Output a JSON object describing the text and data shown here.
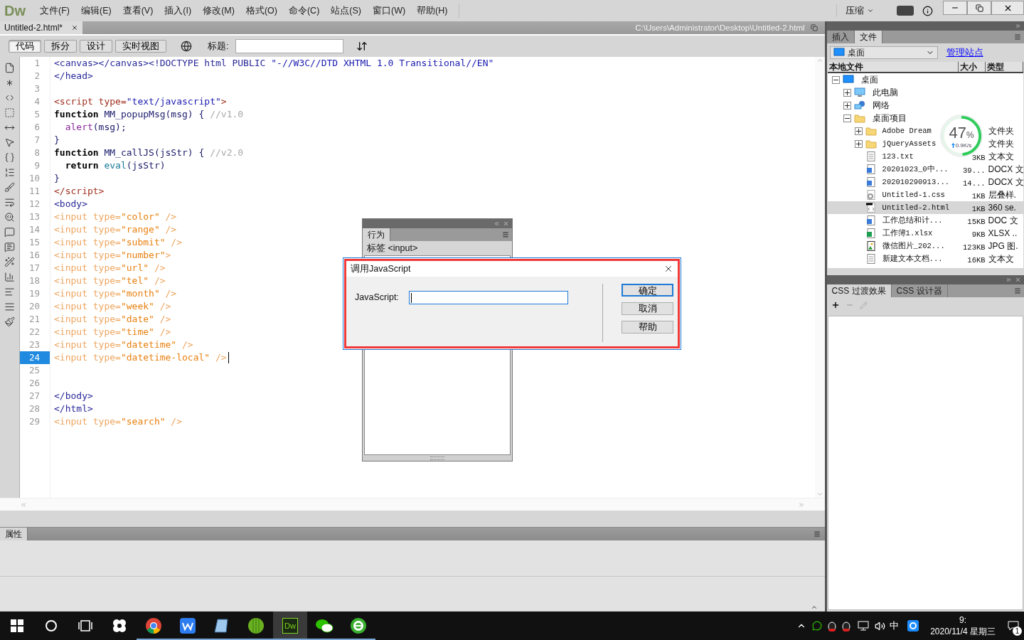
{
  "app": {
    "logo": "Dw",
    "menus": [
      "文件(F)",
      "编辑(E)",
      "查看(V)",
      "插入(I)",
      "修改(M)",
      "格式(O)",
      "命令(C)",
      "站点(S)",
      "窗口(W)",
      "帮助(H)"
    ],
    "workspace": "压缩"
  },
  "document": {
    "tab": "Untitled-2.html*",
    "path": "C:\\Users\\Administrator\\Desktop\\Untitled-2.html"
  },
  "toolbar": {
    "views": [
      {
        "label": "代码",
        "selected": true
      },
      {
        "label": "拆分",
        "selected": false
      },
      {
        "label": "设计",
        "selected": false
      },
      {
        "label": "实时视图",
        "selected": false
      }
    ],
    "title_label": "标题:"
  },
  "code": [
    {
      "number": "1",
      "current": false,
      "tokens": [
        {
          "kind": "markup",
          "text": "<canvas></canvas><!DOCTYPE html PUBLIC "
        },
        {
          "kind": "string",
          "text": "\"-//W3C//DTD XHTML 1.0 Transitional//EN\""
        }
      ]
    },
    {
      "number": "2",
      "current": false,
      "tokens": [
        {
          "kind": "markup",
          "text": "</head>"
        }
      ]
    },
    {
      "number": "3",
      "current": false
    },
    {
      "number": "4",
      "current": false,
      "tokens": [
        {
          "kind": "script_tag",
          "text": "<script type="
        },
        {
          "kind": "string",
          "text": "\"text/javascript\""
        },
        {
          "kind": "script_tag",
          "text": ">"
        }
      ]
    },
    {
      "number": "5",
      "current": false,
      "tokens": [
        {
          "kind": "keyword",
          "text": "function"
        },
        {
          "kind": "name",
          "text": " MM_popupMsg(msg) { "
        },
        {
          "kind": "comment",
          "text": "//v1.0"
        }
      ]
    },
    {
      "number": "6",
      "current": false,
      "tokens": [
        {
          "kind": "builtin",
          "text": "  alert"
        },
        {
          "kind": "name",
          "text": "(msg);"
        }
      ]
    },
    {
      "number": "7",
      "current": false,
      "tokens": [
        {
          "kind": "name",
          "text": "}"
        }
      ]
    },
    {
      "number": "8",
      "current": false,
      "tokens": [
        {
          "kind": "keyword",
          "text": "function"
        },
        {
          "kind": "name",
          "text": " MM_callJS(jsStr) { "
        },
        {
          "kind": "comment",
          "text": "//v2.0"
        }
      ]
    },
    {
      "number": "9",
      "current": false,
      "tokens": [
        {
          "kind": "keyword",
          "text": "  return"
        },
        {
          "kind": "call",
          "text": " eval"
        },
        {
          "kind": "name",
          "text": "(jsStr)"
        }
      ]
    },
    {
      "number": "10",
      "current": false,
      "tokens": [
        {
          "kind": "name",
          "text": "}"
        }
      ]
    },
    {
      "number": "11",
      "current": false,
      "tokens": [
        {
          "kind": "script_tag",
          "text": "</script>"
        }
      ]
    },
    {
      "number": "12",
      "current": false,
      "tokens": [
        {
          "kind": "markup",
          "text": "<body>"
        }
      ]
    },
    {
      "number": "13",
      "current": false,
      "tokens": [
        {
          "kind": "dim_tag",
          "text": "<input type="
        },
        {
          "kind": "dim_string",
          "text": "\"color\""
        },
        {
          "kind": "dim_tag",
          "text": " />"
        }
      ]
    },
    {
      "number": "14",
      "current": false,
      "tokens": [
        {
          "kind": "dim_tag",
          "text": "<input type="
        },
        {
          "kind": "dim_string",
          "text": "\"range\""
        },
        {
          "kind": "dim_tag",
          "text": " />"
        }
      ]
    },
    {
      "number": "15",
      "current": false,
      "tokens": [
        {
          "kind": "dim_tag",
          "text": "<input type="
        },
        {
          "kind": "dim_string",
          "text": "\"submit\""
        },
        {
          "kind": "dim_tag",
          "text": " />"
        }
      ]
    },
    {
      "number": "16",
      "current": false,
      "tokens": [
        {
          "kind": "dim_tag",
          "text": "<input type="
        },
        {
          "kind": "dim_string",
          "text": "\"number\""
        },
        {
          "kind": "dim_tag",
          "text": ">"
        }
      ]
    },
    {
      "number": "17",
      "current": false,
      "tokens": [
        {
          "kind": "dim_tag",
          "text": "<input type="
        },
        {
          "kind": "dim_string",
          "text": "\"url\""
        },
        {
          "kind": "dim_tag",
          "text": " />"
        }
      ]
    },
    {
      "number": "18",
      "current": false,
      "tokens": [
        {
          "kind": "dim_tag",
          "text": "<input type="
        },
        {
          "kind": "dim_string",
          "text": "\"tel\""
        },
        {
          "kind": "dim_tag",
          "text": " />"
        }
      ]
    },
    {
      "number": "19",
      "current": false,
      "tokens": [
        {
          "kind": "dim_tag",
          "text": "<input type="
        },
        {
          "kind": "dim_string",
          "text": "\"month\""
        },
        {
          "kind": "dim_tag",
          "text": " />"
        }
      ]
    },
    {
      "number": "20",
      "current": false,
      "tokens": [
        {
          "kind": "dim_tag",
          "text": "<input type="
        },
        {
          "kind": "dim_string",
          "text": "\"week\""
        },
        {
          "kind": "dim_tag",
          "text": " />"
        }
      ]
    },
    {
      "number": "21",
      "current": false,
      "tokens": [
        {
          "kind": "dim_tag",
          "text": "<input type="
        },
        {
          "kind": "dim_string",
          "text": "\"date\""
        },
        {
          "kind": "dim_tag",
          "text": " />"
        }
      ]
    },
    {
      "number": "22",
      "current": false,
      "tokens": [
        {
          "kind": "dim_tag",
          "text": "<input type="
        },
        {
          "kind": "dim_string",
          "text": "\"time\""
        },
        {
          "kind": "dim_tag",
          "text": " />"
        }
      ]
    },
    {
      "number": "23",
      "current": false,
      "tokens": [
        {
          "kind": "dim_tag",
          "text": "<input type="
        },
        {
          "kind": "dim_string",
          "text": "\"datetime\""
        },
        {
          "kind": "dim_tag",
          "text": " />"
        }
      ]
    },
    {
      "number": "24",
      "current": true,
      "tokens": [
        {
          "kind": "dim_tag",
          "text": "<input type="
        },
        {
          "kind": "dim_string",
          "text": "\"datetime-local\""
        },
        {
          "kind": "dim_tag",
          "text": " />"
        }
      ]
    },
    {
      "number": "25",
      "current": false
    },
    {
      "number": "26",
      "current": false
    },
    {
      "number": "27",
      "current": false,
      "tokens": [
        {
          "kind": "markup",
          "text": "</body>"
        }
      ]
    },
    {
      "number": "28",
      "current": false,
      "tokens": [
        {
          "kind": "markup",
          "text": "</html>"
        }
      ]
    },
    {
      "number": "29",
      "current": false,
      "tokens": [
        {
          "kind": "dim_tag",
          "text": "<input type="
        },
        {
          "kind": "dim_string",
          "text": "\"search\""
        },
        {
          "kind": "dim_tag",
          "text": " />"
        }
      ]
    }
  ],
  "behaviors_panel": {
    "tab": "行为",
    "tag_label": "标签 <input>"
  },
  "dialog": {
    "title": "调用JavaScript",
    "field_label": "JavaScript:",
    "buttons": [
      {
        "label": "确定",
        "default": true
      },
      {
        "label": "取消",
        "default": false
      },
      {
        "label": "帮助",
        "default": false
      }
    ]
  },
  "files_panel": {
    "tabs": [
      {
        "label": "插入",
        "selected": false
      },
      {
        "label": "文件",
        "selected": true
      }
    ],
    "location": "桌面",
    "manage_link": "管理站点",
    "columns": [
      "本地文件",
      "大小",
      "类型"
    ],
    "tree": [
      {
        "name": "桌面",
        "kind": "monitor",
        "expanded": true,
        "selected": false,
        "children": [
          {
            "name": "此电脑",
            "kind": "pc",
            "expanded": false,
            "selected": false
          },
          {
            "name": "网络",
            "kind": "network",
            "expanded": false,
            "selected": false
          },
          {
            "name": "桌面项目",
            "kind": "folder",
            "expanded": true,
            "selected": false,
            "children": [
              {
                "name": "Adobe Dream",
                "kind": "folder",
                "expanded": false,
                "selected": false,
                "type": "文件夹"
              },
              {
                "name": "jQueryAssets",
                "kind": "folder",
                "expanded": false,
                "selected": false,
                "type": "文件夹"
              },
              {
                "name": "123.txt",
                "kind": "text",
                "selected": false,
                "size": "3KB",
                "type": "文本文"
              },
              {
                "name": "20201023_0中...",
                "kind": "word",
                "selected": false,
                "size": "39...",
                "type": "DOCX 文"
              },
              {
                "name": "202010290913...",
                "kind": "word",
                "selected": false,
                "size": "14...",
                "type": "DOCX 文"
              },
              {
                "name": "Untitled-1.css",
                "kind": "css",
                "selected": false,
                "size": "1KB",
                "type": "层叠样."
              },
              {
                "name": "Untitled-2.html",
                "kind": "html",
                "selected": true,
                "size": "1KB",
                "type": "360 se."
              },
              {
                "name": "工作总结和计...",
                "kind": "word",
                "selected": false,
                "size": "15KB",
                "type": "DOC 文"
              },
              {
                "name": "工作簿1.xlsx",
                "kind": "sheet",
                "selected": false,
                "size": "9KB",
                "type": "XLSX .."
              },
              {
                "name": "微信图片_202...",
                "kind": "image",
                "selected": false,
                "size": "123KB",
                "type": "JPG 图."
              },
              {
                "name": "新建文本文档...",
                "kind": "text",
                "selected": false,
                "size": "16KB",
                "type": "文本文"
              }
            ]
          }
        ]
      }
    ]
  },
  "speed_widget": {
    "percent": "47",
    "unit": "%",
    "rate": "0.9K/s",
    "level": 0.47
  },
  "css_panel": {
    "tabs": [
      {
        "label": "CSS 过渡效果",
        "selected": true
      },
      {
        "label": "CSS 设计器",
        "selected": false
      }
    ]
  },
  "properties_panel": {
    "tab": "属性"
  },
  "taskbar": {
    "apps": [
      {
        "kind": "pinwheel",
        "running": false,
        "active": false
      },
      {
        "kind": "chrome",
        "running": true,
        "active": false
      },
      {
        "kind": "wps",
        "running": true,
        "active": false
      },
      {
        "kind": "tablet",
        "running": true,
        "active": false
      },
      {
        "kind": "ball",
        "running": true,
        "active": false
      },
      {
        "kind": "dw",
        "label": "Dw",
        "running": true,
        "active": true
      },
      {
        "kind": "wechat",
        "running": true,
        "active": false
      },
      {
        "kind": "browser",
        "running": true,
        "active": false
      }
    ],
    "ime": "中",
    "time": "9:",
    "date": "2020/11/4 星期三",
    "notifications": "1"
  }
}
